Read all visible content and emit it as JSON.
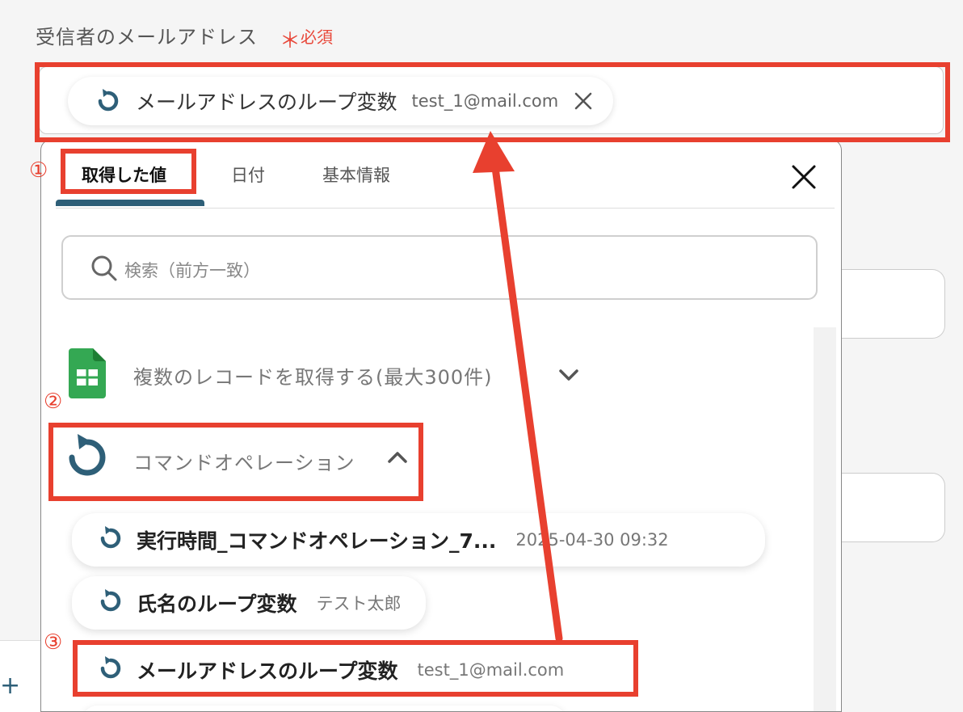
{
  "field": {
    "label": "受信者のメールアドレス",
    "required_mark": "＊",
    "required_text": "必須"
  },
  "selected_chip": {
    "label": "メールアドレスのループ変数",
    "value": "test_1@mail.com",
    "icon": "loop-icon",
    "remove_icon": "close-icon"
  },
  "tabs": [
    {
      "label": "取得した値",
      "active": true
    },
    {
      "label": "日付",
      "active": false
    },
    {
      "label": "基本情報",
      "active": false
    }
  ],
  "search": {
    "placeholder": "検索（前方一致）"
  },
  "groups": [
    {
      "title": "複数のレコードを取得する(最大300件)",
      "icon": "spreadsheet-icon",
      "expanded": false
    },
    {
      "title": "コマンドオペレーション",
      "icon": "loop-icon",
      "expanded": true,
      "items": [
        {
          "label": "実行時間_コマンドオペレーション_7...",
          "value": "2025-04-30 09:32"
        },
        {
          "label": "氏名のループ変数",
          "value": "テスト太郎"
        },
        {
          "label": "メールアドレスのループ変数",
          "value": "test_1@mail.com"
        }
      ]
    }
  ],
  "annotations": {
    "n1": "①",
    "n2": "②",
    "n3": "③"
  },
  "colors": {
    "accent": "#2e5f78",
    "highlight": "#e8402f",
    "required": "#e8483a",
    "sheet_green": "#34a853"
  }
}
